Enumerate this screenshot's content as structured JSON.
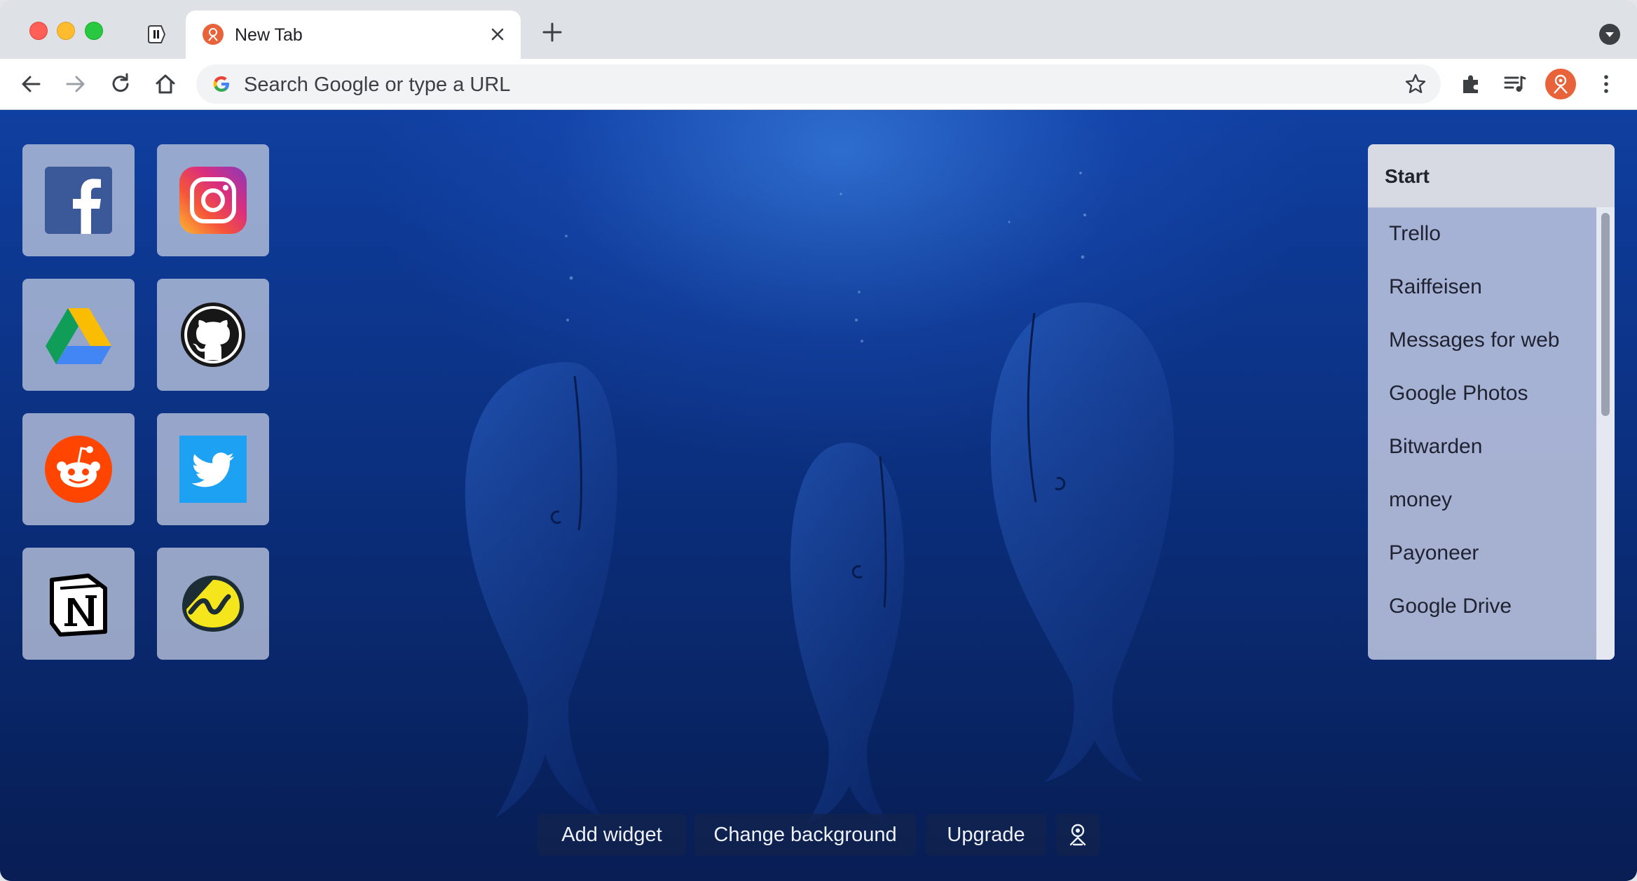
{
  "browser": {
    "tab": {
      "title": "New Tab"
    },
    "omnibox": {
      "placeholder": "Search Google or type a URL"
    }
  },
  "colors": {
    "accent": "#e8623a",
    "background_deep": "#0a2a72",
    "tile_bg": "#bec6de"
  },
  "shortcuts": [
    {
      "name": "facebook",
      "icon": "facebook-icon"
    },
    {
      "name": "instagram",
      "icon": "instagram-icon"
    },
    {
      "name": "google-drive",
      "icon": "google-drive-icon"
    },
    {
      "name": "github",
      "icon": "github-icon"
    },
    {
      "name": "reddit",
      "icon": "reddit-icon"
    },
    {
      "name": "twitter",
      "icon": "twitter-icon"
    },
    {
      "name": "notion",
      "icon": "notion-icon"
    },
    {
      "name": "basecamp",
      "icon": "basecamp-icon"
    }
  ],
  "widget": {
    "title": "Start",
    "links": [
      "Trello",
      "Raiffeisen",
      "Messages for web",
      "Google Photos",
      "Bitwarden",
      "money",
      "Payoneer",
      "Google Drive"
    ]
  },
  "bottom_bar": {
    "add_widget": "Add widget",
    "change_background": "Change background",
    "upgrade": "Upgrade"
  }
}
